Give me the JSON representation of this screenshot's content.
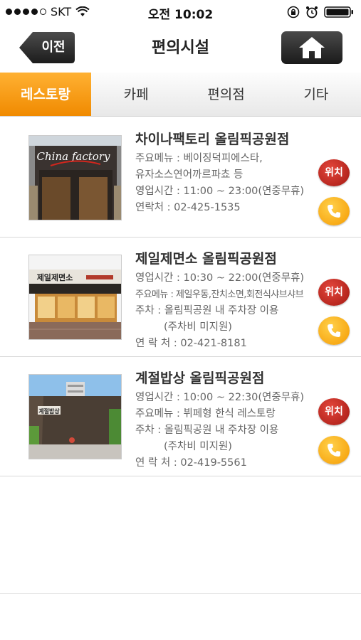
{
  "status": {
    "carrier": "SKT",
    "time": "오전 10:02"
  },
  "header": {
    "back_label": "이전",
    "title": "편의시설"
  },
  "tabs": [
    {
      "label": "레스토랑",
      "active": true
    },
    {
      "label": "카페",
      "active": false
    },
    {
      "label": "편의점",
      "active": false
    },
    {
      "label": "기타",
      "active": false
    }
  ],
  "restaurants": [
    {
      "name": "차이나팩토리 올림픽공원점",
      "lines": [
        "주요메뉴 : 베이징덕피에스타,",
        "유자소스연어까르파쵸 등",
        "영업시간 : 11:00 ~ 23:00(연중무휴)",
        "연락처 : 02-425-1535"
      ],
      "sign": "China factory"
    },
    {
      "name": "제일제면소 올림픽공원점",
      "lines": [
        "영업시간 : 10:30 ~ 22:00(연중무휴)",
        "주요메뉴 : 제일우동,잔치소면,회전식샤브샤브",
        "주차 : 올림픽공원 내 주차장 이용",
        "(주차비 미지원)",
        "연 락 처 : 02-421-8181"
      ],
      "sign": "제일제면소"
    },
    {
      "name": "계절밥상 올림픽공원점",
      "lines": [
        "영업시간 : 10:00 ~ 22:30(연중무휴)",
        "주요메뉴 : 뷔페형 한식 레스토랑",
        "주차 : 올림픽공원 내 주차장 이용",
        "(주차비 미지원)",
        "연 락 처 : 02-419-5561"
      ],
      "sign": "계절밥상"
    }
  ],
  "location_label": "위치",
  "icons": {
    "back": "back-arrow-icon",
    "home": "home-icon",
    "call": "phone-icon"
  },
  "colors": {
    "accent": "#f59a00",
    "location": "#c1271d"
  }
}
